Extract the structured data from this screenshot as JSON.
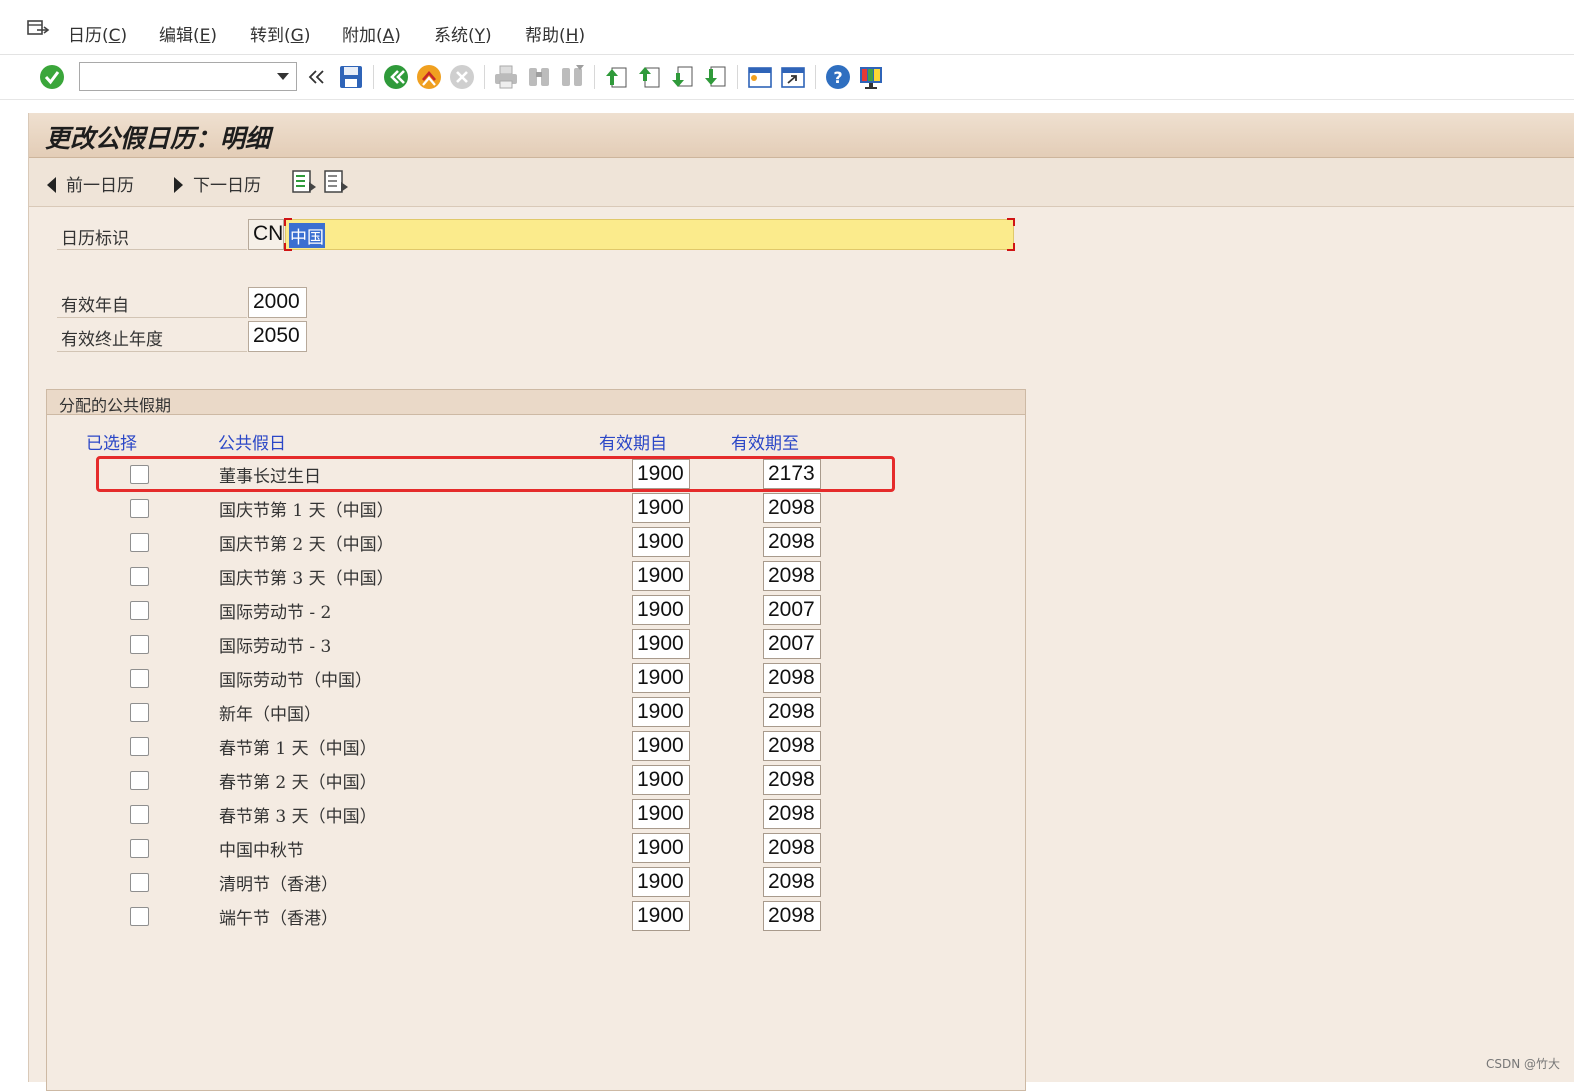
{
  "menu": {
    "items": [
      {
        "label": "日历(C)",
        "text": "日历(",
        "key": "C",
        "end": ")"
      },
      {
        "label": "编辑(E)",
        "text": "编辑(",
        "key": "E",
        "end": ")"
      },
      {
        "label": "转到(G)",
        "text": "转到(",
        "key": "G",
        "end": ")"
      },
      {
        "label": "附加(A)",
        "text": "附加(",
        "key": "A",
        "end": ")"
      },
      {
        "label": "系统(Y)",
        "text": "系统(",
        "key": "Y",
        "end": ")"
      },
      {
        "label": "帮助(H)",
        "text": "帮助(",
        "key": "H",
        "end": ")"
      }
    ]
  },
  "toolbar": {
    "command_field_value": "",
    "icons": [
      "enter-check-icon",
      "save-icon",
      "back-icon",
      "exit-icon",
      "cancel-icon",
      "print-icon",
      "find-icon",
      "find-next-icon",
      "first-page-icon",
      "previous-page-icon",
      "next-page-icon",
      "last-page-icon",
      "create-session-icon",
      "shortcut-icon",
      "help-icon",
      "customize-layout-icon"
    ],
    "colors": {
      "check": "#3aa63a",
      "back": "#2f9a3a",
      "exit": "#f0a020",
      "cancel": "#c8c8c8",
      "help": "#2f6fc0"
    }
  },
  "screen": {
    "title": "更改公假日历：明细",
    "prev_button": "前一日历",
    "next_button": "下一日历"
  },
  "form": {
    "calendar_id_label": "日历标识",
    "calendar_id_value": "CN",
    "calendar_desc_value": "中国",
    "valid_from_label": "有效年自",
    "valid_from_value": "2000",
    "valid_to_label": "有效终止年度",
    "valid_to_value": "2050"
  },
  "group": {
    "title": "分配的公共假期",
    "columns": {
      "selected": "已选择",
      "holiday": "公共假日",
      "valid_from": "有效期自",
      "valid_to": "有效期至"
    },
    "rows": [
      {
        "name": "董事长过生日",
        "from": "1900",
        "to": "2173"
      },
      {
        "name": "国庆节第 1 天（中国）",
        "from": "1900",
        "to": "2098"
      },
      {
        "name": "国庆节第 2 天（中国）",
        "from": "1900",
        "to": "2098"
      },
      {
        "name": "国庆节第 3 天（中国）",
        "from": "1900",
        "to": "2098"
      },
      {
        "name": "国际劳动节 - 2",
        "from": "1900",
        "to": "2007"
      },
      {
        "name": "国际劳动节 - 3",
        "from": "1900",
        "to": "2007"
      },
      {
        "name": "国际劳动节（中国）",
        "from": "1900",
        "to": "2098"
      },
      {
        "name": "新年（中国）",
        "from": "1900",
        "to": "2098"
      },
      {
        "name": "春节第 1 天（中国）",
        "from": "1900",
        "to": "2098"
      },
      {
        "name": "春节第 2 天（中国）",
        "from": "1900",
        "to": "2098"
      },
      {
        "name": "春节第 3 天（中国）",
        "from": "1900",
        "to": "2098"
      },
      {
        "name": "中国中秋节",
        "from": "1900",
        "to": "2098"
      },
      {
        "name": "清明节（香港）",
        "from": "1900",
        "to": "2098"
      },
      {
        "name": "端午节（香港）",
        "from": "1900",
        "to": "2098"
      }
    ]
  },
  "watermark": "CSDN @竹大",
  "colors": {
    "highlight": "#e52b2b",
    "selected_field": "#fbeb8c",
    "column_header": "#2b47c7"
  }
}
